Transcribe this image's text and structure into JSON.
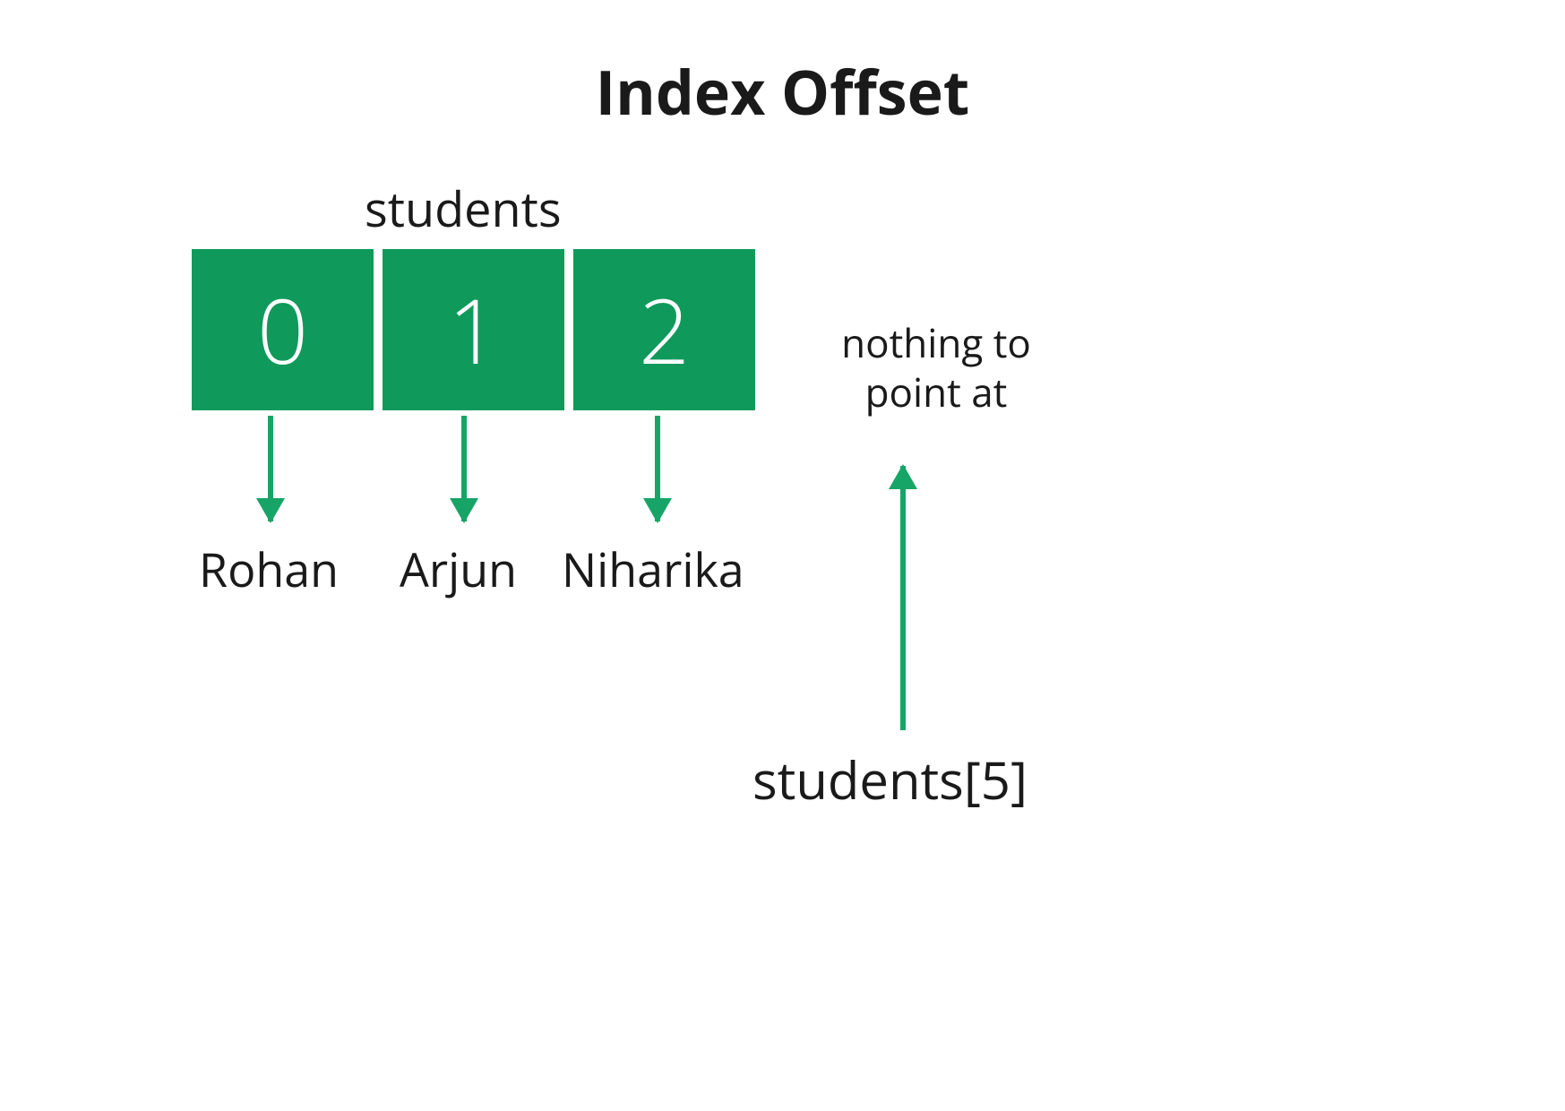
{
  "title": "Index Offset",
  "array_name": "students",
  "cells": [
    {
      "index": "0",
      "value": "Rohan"
    },
    {
      "index": "1",
      "value": "Arjun"
    },
    {
      "index": "2",
      "value": "Niharika"
    }
  ],
  "out_of_bounds": {
    "message": "nothing to point at",
    "expression": "students[5]"
  },
  "colors": {
    "cell_bg": "#0f9a5b",
    "arrow": "#16a566",
    "text": "#1a1a1a"
  }
}
